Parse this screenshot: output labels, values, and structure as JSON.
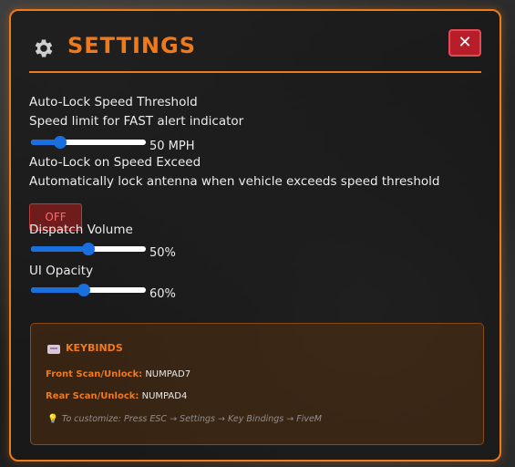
{
  "header": {
    "title": "SETTINGS",
    "close_label": "✕"
  },
  "settings": {
    "speed_threshold": {
      "label": "Auto-Lock Speed Threshold",
      "description": "Speed limit for FAST alert indicator",
      "value_text": "50 MPH",
      "fraction": 0.25
    },
    "auto_lock": {
      "label": "Auto-Lock on Speed Exceed",
      "description": "Automatically lock antenna when vehicle exceeds speed threshold",
      "toggle_label": "OFF",
      "enabled": false
    },
    "dispatch_volume": {
      "label": "Dispatch Volume",
      "value_text": "50%",
      "fraction": 0.5
    },
    "ui_opacity": {
      "label": "UI Opacity",
      "value_text": "60%",
      "fraction": 0.46
    }
  },
  "keybinds": {
    "title": "KEYBINDS",
    "front": {
      "label": "Front Scan/Unlock:",
      "key": "NUMPAD7"
    },
    "rear": {
      "label": "Rear Scan/Unlock:",
      "key": "NUMPAD4"
    },
    "tip": "To customize: Press ESC → Settings → Key Bindings → FiveM"
  },
  "colors": {
    "accent": "#f07a1a",
    "close_red": "#b81d2a",
    "slider_blue": "#1a6fdf",
    "off_red": "#6e1c1c"
  },
  "icons": {
    "header": "gear-icon",
    "keybinds": "keyboard-icon",
    "tip": "lightbulb-icon"
  }
}
